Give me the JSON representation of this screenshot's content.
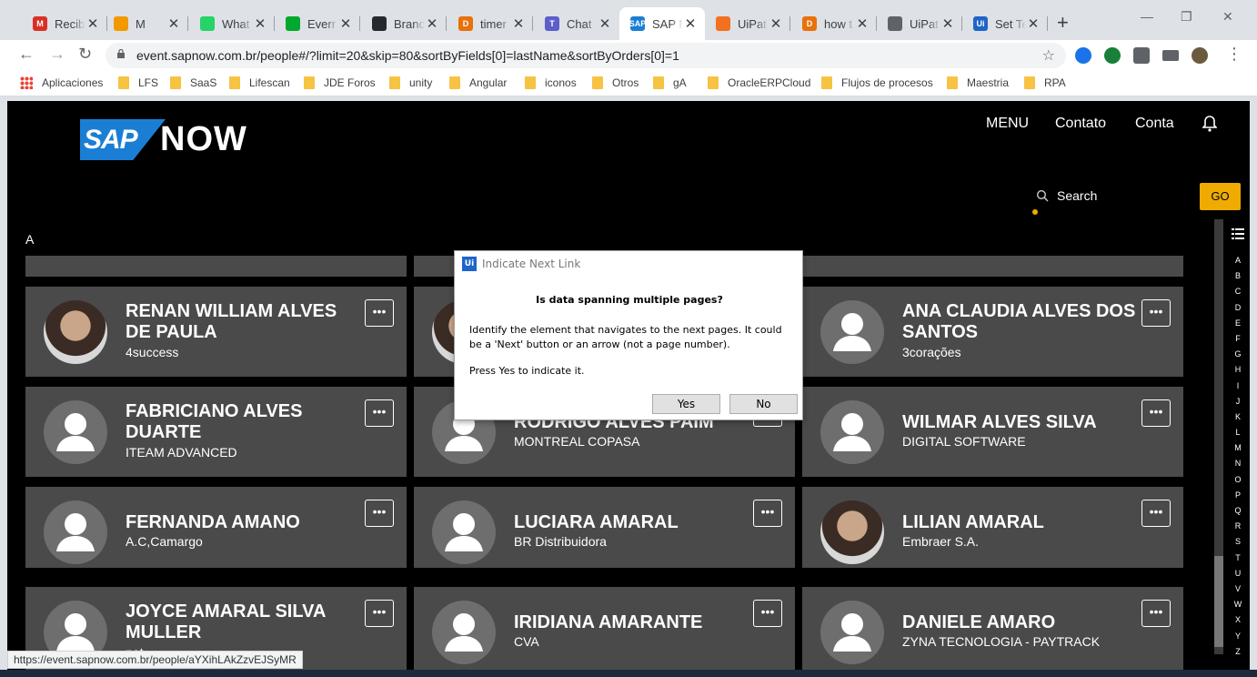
{
  "browser": {
    "tabs": [
      {
        "title": "Recib",
        "fav_color": "#d93025",
        "fav_text": "M"
      },
      {
        "title": "M",
        "fav_color": "#f29900",
        "fav_text": ""
      },
      {
        "title": "What",
        "fav_color": "#25d366",
        "fav_text": ""
      },
      {
        "title": "Everr",
        "fav_color": "#00a82d",
        "fav_text": ""
      },
      {
        "title": "Branc",
        "fav_color": "#24292e",
        "fav_text": ""
      },
      {
        "title": "timer",
        "fav_color": "#e8710a",
        "fav_text": "D"
      },
      {
        "title": "Chat",
        "fav_color": "#5b5fc7",
        "fav_text": "T"
      },
      {
        "title": "SAP N",
        "fav_color": "#1a7fd4",
        "fav_text": "SAP"
      },
      {
        "title": "UiPat",
        "fav_color": "#f37021",
        "fav_text": ""
      },
      {
        "title": "how t",
        "fav_color": "#e8710a",
        "fav_text": "D"
      },
      {
        "title": "UiPat",
        "fav_color": "#5f6368",
        "fav_text": ""
      },
      {
        "title": "Set Te",
        "fav_color": "#1f64c8",
        "fav_text": "Ui"
      }
    ],
    "url": "event.sapnow.com.br/people#/?limit=20&skip=80&sortByFields[0]=lastName&sortByOrders[0]=1",
    "bookmarks": [
      "Aplicaciones",
      "LFS",
      "SaaS",
      "Lifescan",
      "JDE Foros",
      "unity",
      "Angular",
      "iconos",
      "Otros",
      "gA",
      "OracleERPCloud",
      "Flujos de procesos",
      "Maestria",
      "RPA"
    ],
    "status_url": "https://event.sapnow.com.br/people/aYXihLAkZzvEJSyMR"
  },
  "site": {
    "logo_sap": "SAP",
    "logo_now": "NOW",
    "nav": {
      "menu": "MENU",
      "contact": "Contato",
      "account": "Conta"
    },
    "search_label": "Search",
    "go_label": "GO",
    "letter": "A"
  },
  "people": [
    {
      "name": "RENAN WILLIAM ALVES DE PAULA",
      "company": "4success",
      "photo": "photo"
    },
    {
      "name": "",
      "company": "",
      "photo": "photo"
    },
    {
      "name": "ANA CLAUDIA ALVES DOS SANTOS",
      "company": "3corações",
      "photo": "placeholder"
    },
    {
      "name": "FABRICIANO ALVES DUARTE",
      "company": "ITEAM ADVANCED",
      "photo": "placeholder"
    },
    {
      "name": "RODRIGO ALVES PAIM",
      "company": "MONTREAL COPASA",
      "photo": "placeholder"
    },
    {
      "name": "WILMAR ALVES SILVA",
      "company": "DIGITAL SOFTWARE",
      "photo": "placeholder"
    },
    {
      "name": "FERNANDA AMANO",
      "company": "A.C,Camargo",
      "photo": "placeholder"
    },
    {
      "name": "LUCIARA AMARAL",
      "company": "BR Distribuidora",
      "photo": "placeholder"
    },
    {
      "name": "LILIAN AMARAL",
      "company": "Embraer S.A.",
      "photo": "photo"
    },
    {
      "name": "JOYCE AMARAL SILVA MULLER",
      "company": "net",
      "photo": "placeholder"
    },
    {
      "name": "IRIDIANA AMARANTE",
      "company": "CVA",
      "photo": "placeholder"
    },
    {
      "name": "DANIELE AMARO",
      "company": "ZYNA TECNOLOGIA - PAYTRACK",
      "photo": "placeholder"
    }
  ],
  "more_label": "•••",
  "alphabet": [
    "A",
    "B",
    "C",
    "D",
    "E",
    "F",
    "G",
    "H",
    "I",
    "J",
    "K",
    "L",
    "M",
    "N",
    "O",
    "P",
    "Q",
    "R",
    "S",
    "T",
    "U",
    "V",
    "W",
    "X",
    "Y",
    "Z"
  ],
  "dialog": {
    "title": "Indicate Next Link",
    "icon_text": "Ui",
    "question": "Is data spanning multiple pages?",
    "message": "Identify the element that navigates to the next pages. It could be a 'Next' button or an arrow (not a page number).",
    "message2": "Press Yes to indicate it.",
    "yes": "Yes",
    "no": "No"
  },
  "colors": {
    "accent": "#f0ab00",
    "card": "#4a4a4a",
    "sap_blue": "#1a7fd4"
  }
}
